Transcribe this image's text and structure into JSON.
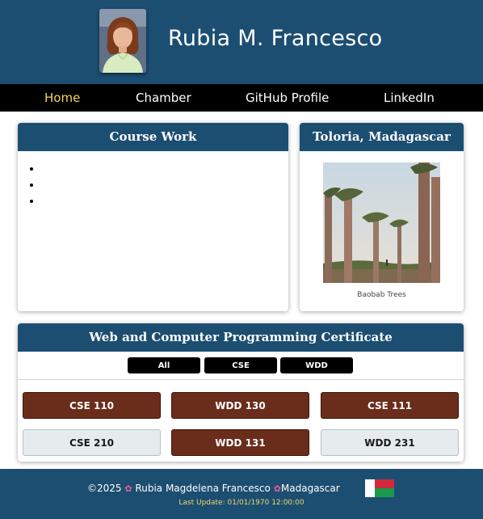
{
  "header": {
    "name": "Rubia M. Francesco"
  },
  "nav": {
    "items": [
      "Home",
      "Chamber",
      "GitHub Profile",
      "LinkedIn"
    ],
    "active": "Home"
  },
  "course_work": {
    "title": "Course Work",
    "items": [
      "",
      "",
      ""
    ]
  },
  "location": {
    "title": "Toloria, Madagascar",
    "caption": "Baobab Trees"
  },
  "certificate": {
    "title": "Web and Computer Programming Certificate",
    "filters": [
      "All",
      "CSE",
      "WDD"
    ],
    "courses": [
      {
        "label": "CSE 110",
        "completed": true
      },
      {
        "label": "WDD 130",
        "completed": true
      },
      {
        "label": "CSE 111",
        "completed": true
      },
      {
        "label": "CSE 210",
        "completed": false
      },
      {
        "label": "WDD 131",
        "completed": true
      },
      {
        "label": "WDD 231",
        "completed": false
      }
    ]
  },
  "footer": {
    "year_prefix": "©2025",
    "author": "Rubia Magdelena Francesco",
    "country": "Madagascar",
    "last_update": "Last Update: 01/01/1970 12:00:00"
  },
  "colors": {
    "primary": "#1c4e72",
    "accent": "#f0d86a",
    "completed": "#6b2d1b",
    "pending": "#e6ecee",
    "nav_bg": "#000000"
  },
  "icons": {
    "footer_separator": "flower-icon",
    "flag": "madagascar-flag-icon"
  }
}
